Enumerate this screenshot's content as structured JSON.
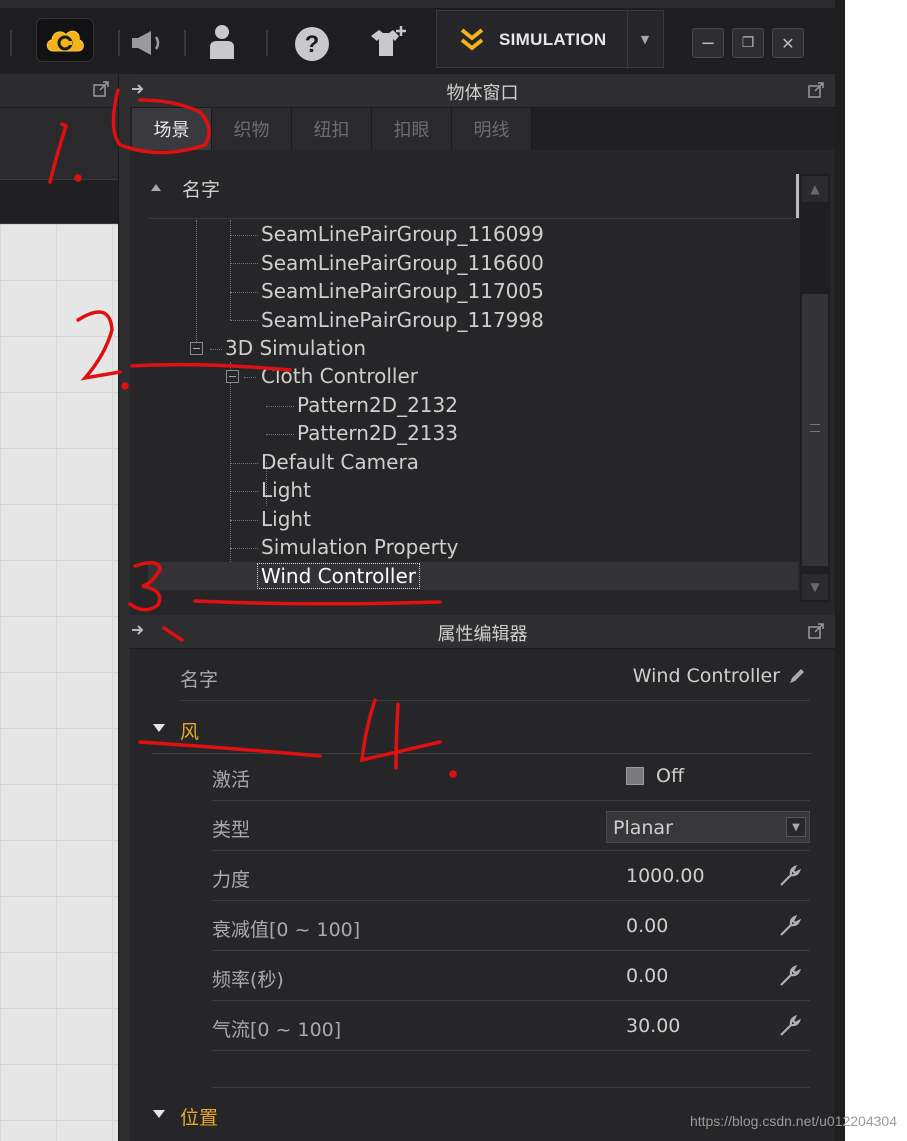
{
  "toolbar": {
    "mode_label": "SIMULATION",
    "icons": [
      "cloud-icon",
      "speaker-icon",
      "avatar-icon",
      "help-icon",
      "add-garment-icon",
      "simulation-chevron-icon"
    ],
    "window_buttons": [
      "minimize",
      "restore",
      "close"
    ],
    "accent_color": "#f2b31b"
  },
  "object_window": {
    "title": "物体窗口",
    "tabs": [
      {
        "label": "场景",
        "active": true
      },
      {
        "label": "织物",
        "active": false
      },
      {
        "label": "纽扣",
        "active": false
      },
      {
        "label": "扣眼",
        "active": false
      },
      {
        "label": "明线",
        "active": false
      }
    ],
    "tree_header": "名字",
    "tree": {
      "seam_items": [
        "SeamLinePairGroup_116099",
        "SeamLinePairGroup_116600",
        "SeamLinePairGroup_117005",
        "SeamLinePairGroup_117998"
      ],
      "simulation_node": "3D Simulation",
      "cloth_controller": "Cloth Controller",
      "patterns": [
        "Pattern2D_2132",
        "Pattern2D_2133"
      ],
      "sim_children": [
        "Default Camera",
        "Light",
        "Light",
        "Simulation Property"
      ],
      "selected": "Wind Controller"
    }
  },
  "property_editor": {
    "title": "属性编辑器",
    "name_label": "名字",
    "name_value": "Wind Controller",
    "wind_section": "风",
    "rows": {
      "activate": {
        "label": "激活",
        "value": "Off"
      },
      "type": {
        "label": "类型",
        "value": "Planar"
      },
      "force": {
        "label": "力度",
        "value": "1000.00"
      },
      "decay": {
        "label": "衰减值[0 ~ 100]",
        "value": "0.00"
      },
      "frequency": {
        "label": "频率(秒)",
        "value": "0.00"
      },
      "turbulence": {
        "label": "气流[0 ~ 100]",
        "value": "30.00"
      }
    },
    "position_section": "位置"
  },
  "watermark": "https://blog.csdn.net/u012204304",
  "section_color": "#e8a92a"
}
